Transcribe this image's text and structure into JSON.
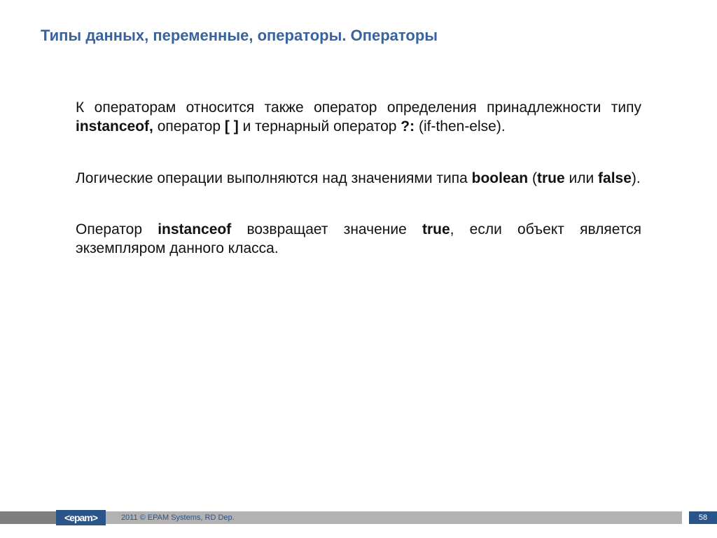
{
  "title": "Типы данных, переменные, операторы. Операторы",
  "paragraphs": {
    "p1": {
      "t1": "К операторам относится также оператор определения принадлежности типу ",
      "b1": "instanceof,",
      "t2": " оператор ",
      "b2": "[ ]",
      "t3": " и тернарный оператор ",
      "b3": "?:",
      "t4": " (if-then-else)."
    },
    "p2": {
      "t1": "Логические операции выполняются над значениями типа ",
      "b1": "boolean",
      "t2": " (",
      "b2": "true",
      "t3": " или ",
      "b3": "false",
      "t4": ")."
    },
    "p3": {
      "t1": "Оператор ",
      "b1": "instanceof",
      "t2": " возвращает значение ",
      "b2": "true",
      "t3": ", если объект является экземпляром данного класса."
    }
  },
  "footer": {
    "logo": "<epam>",
    "copyright": "2011 © EPAM Systems, RD Dep.",
    "page": "58"
  }
}
